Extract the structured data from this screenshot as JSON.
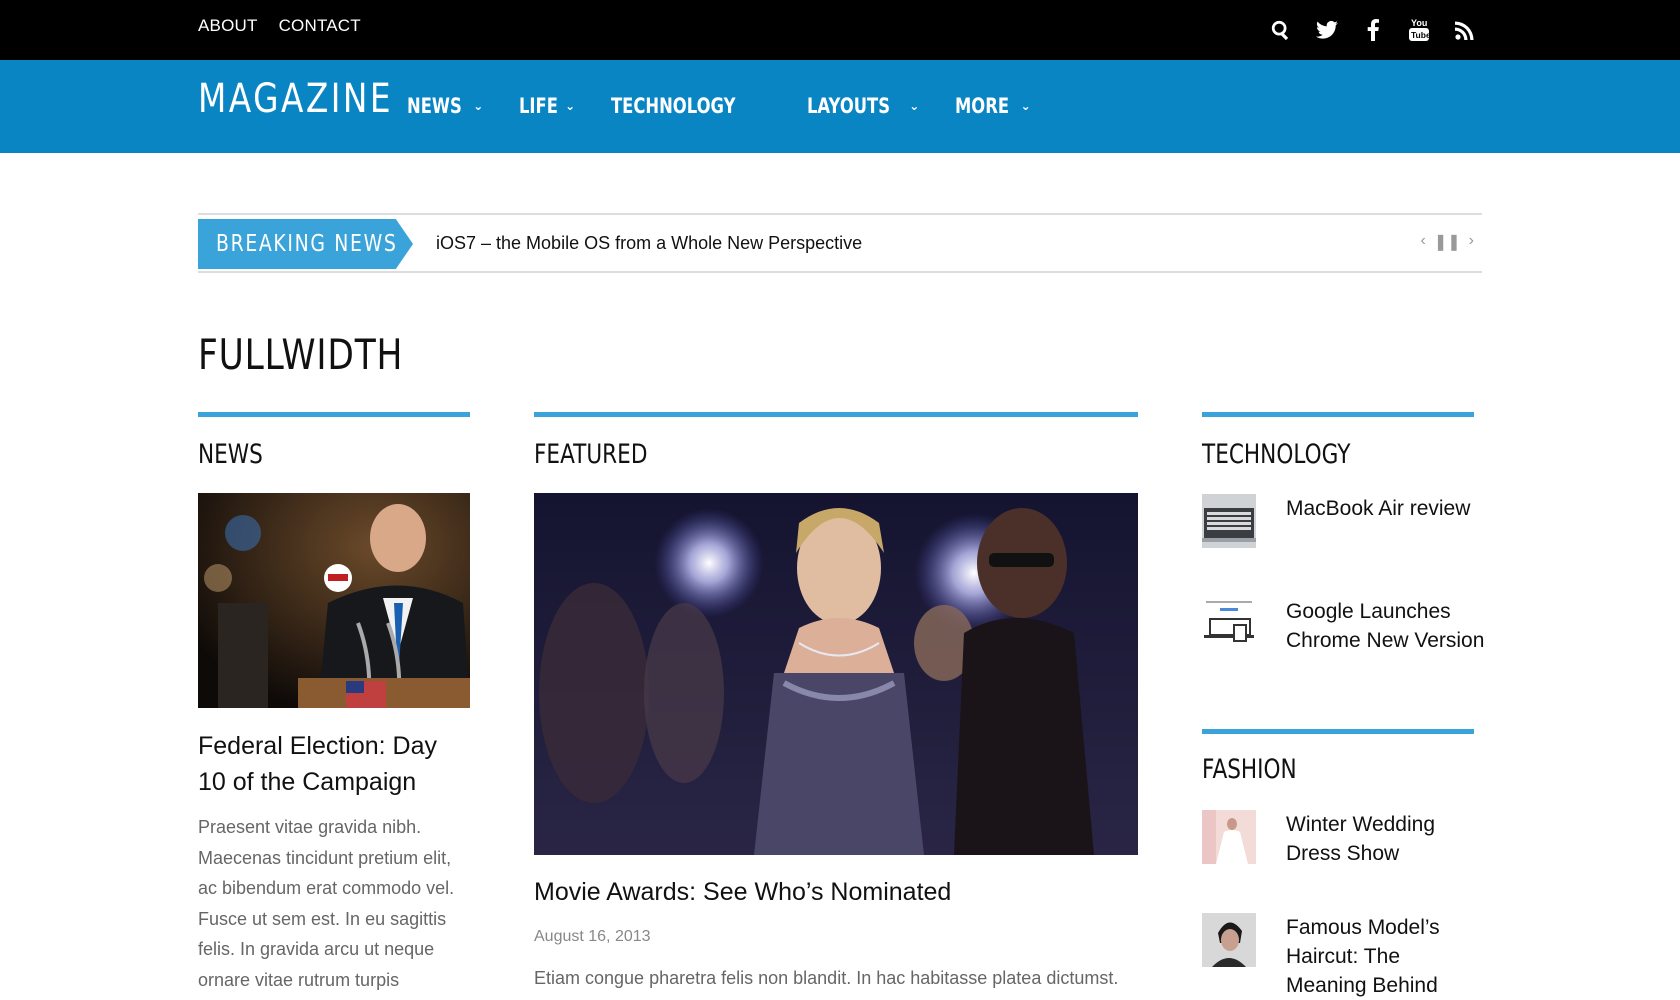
{
  "topbar": {
    "links": [
      "ABOUT",
      "CONTACT"
    ],
    "social_icons": [
      "search-icon",
      "twitter-icon",
      "facebook-icon",
      "youtube-icon",
      "rss-icon"
    ]
  },
  "nav": {
    "logo": "MAGAZINE",
    "items": [
      {
        "label": "NEWS",
        "has_dropdown": true
      },
      {
        "label": "LIFE",
        "has_dropdown": true
      },
      {
        "label": "TECHNOLOGY",
        "has_dropdown": false
      },
      {
        "label": "LAYOUTS",
        "has_dropdown": true
      },
      {
        "label": "MORE",
        "has_dropdown": true
      }
    ],
    "color": "#0a85c4"
  },
  "breaking": {
    "label": "BREAKING NEWS",
    "headline": "iOS7 – the Mobile OS from a Whole New Perspective"
  },
  "page": {
    "title": "FULLWIDTH",
    "accent": "#3aa3d9"
  },
  "news": {
    "heading": "NEWS",
    "title": "Federal Election: Day 10 of the Campaign",
    "excerpt": "Praesent vitae gravida nibh. Maecenas tincidunt pretium elit, ac bibendum erat commodo vel. Fusce ut sem est. In eu sagittis felis. In gravida arcu ut neque ornare vitae rutrum turpis"
  },
  "featured": {
    "heading": "FEATURED",
    "title": "Movie Awards: See Who’s Nominated",
    "date": "August 16, 2013",
    "excerpt": "Etiam congue pharetra felis non blandit. In hac habitasse platea dictumst."
  },
  "technology": {
    "heading": "TECHNOLOGY",
    "items": [
      "MacBook Air review",
      "Google Launches Chrome New Version"
    ]
  },
  "fashion": {
    "heading": "FASHION",
    "items": [
      "Winter Wedding Dress Show",
      "Famous Model’s Haircut: The Meaning Behind"
    ]
  }
}
